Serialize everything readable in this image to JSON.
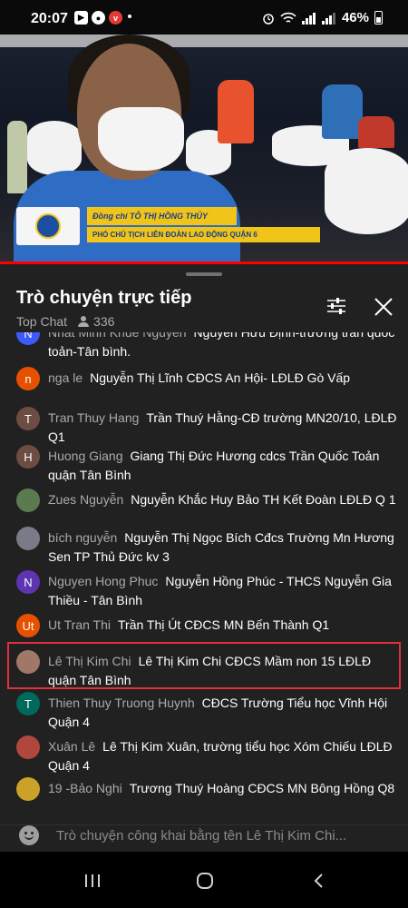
{
  "status_bar": {
    "time": "20:07",
    "battery": "46%",
    "app_icons": [
      "youtube-icon",
      "messenger-icon",
      "vivo-icon"
    ]
  },
  "video": {
    "lower_third_name": "Đồng chí TÔ THỊ HỒNG THỦY",
    "lower_third_role": "PHÓ CHỦ TỊCH LIÊN ĐOÀN LAO ĐỘNG QUẬN 6",
    "progress": 1.0
  },
  "chat": {
    "title": "Trò chuyện trực tiếp",
    "mode": "Top Chat",
    "viewers": "336",
    "messages": [
      {
        "author": "Nhất Minh Khuê Nguyễn",
        "text": "Nguyễn Hữu Định-trường trần quốc toản-Tân bình.",
        "initial": "N",
        "color": "#3d5afe"
      },
      {
        "author": "nga le",
        "text": "Nguyễn Thị Lĩnh CĐCS An Hội- LĐLĐ Gò Vấp",
        "initial": "n",
        "color": "#e65100"
      },
      {
        "author": "Tran Thuy Hang",
        "text": "Trần Thuý Hằng-CĐ trường MN20/10, LĐLĐ Q1",
        "initial": "T",
        "color": "#6d4c41"
      },
      {
        "author": "Huong Giang",
        "text": "Giang Thị Đức Hương cdcs Trần Quốc Toản quận Tân Bình",
        "initial": "H",
        "color": "#6d4c41"
      },
      {
        "author": "Zues Nguyễn",
        "text": "Nguyễn Khắc Huy Bảo TH Kết Đoàn LĐLĐ Q 1",
        "initial": "",
        "color": "#5b7a4f"
      },
      {
        "author": "bích nguyễn",
        "text": "Nguyễn Thị Ngọc Bích Cđcs Trường Mn Hương Sen TP Thủ Đức kv 3",
        "initial": "",
        "color": "#7a7a88"
      },
      {
        "author": "Nguyen Hong Phuc",
        "text": "Nguyễn Hồng Phúc - THCS Nguyễn Gia Thiều - Tân Bình",
        "initial": "N",
        "color": "#5e35b1"
      },
      {
        "author": "Ut Tran Thi",
        "text": "Trần Thị Út CĐCS MN Bến Thành Q1",
        "initial": "Ut",
        "color": "#e65100"
      },
      {
        "author": "Lê Thị Kim Chi",
        "text": "Lê Thị Kim Chi CĐCS Mầm non 15 LĐLĐ quận Tân Bình",
        "initial": "",
        "color": "#a07868"
      },
      {
        "author": "Thien Thuy Truong Huynh",
        "text": "CĐCS Trường Tiểu học Vĩnh Hội Quận 4",
        "initial": "T",
        "color": "#00695c"
      },
      {
        "author": "Xuân Lê",
        "text": "Lê Thị Kim Xuân, trường tiểu học Xóm Chiếu LĐLĐ Quận 4",
        "initial": "",
        "color": "#b0463c"
      },
      {
        "author": "19 -Bảo Nghi",
        "text": "Trương Thuý Hoàng CĐCS MN Bông Hồng Q8",
        "initial": "",
        "color": "#c9a227"
      }
    ]
  },
  "input": {
    "placeholder": "Trò chuyện công khai bằng tên Lê Thị Kim Chi..."
  },
  "colors": {
    "accent_red": "#e0303a",
    "progress_red": "#ff0000",
    "panel_bg": "#212121"
  }
}
